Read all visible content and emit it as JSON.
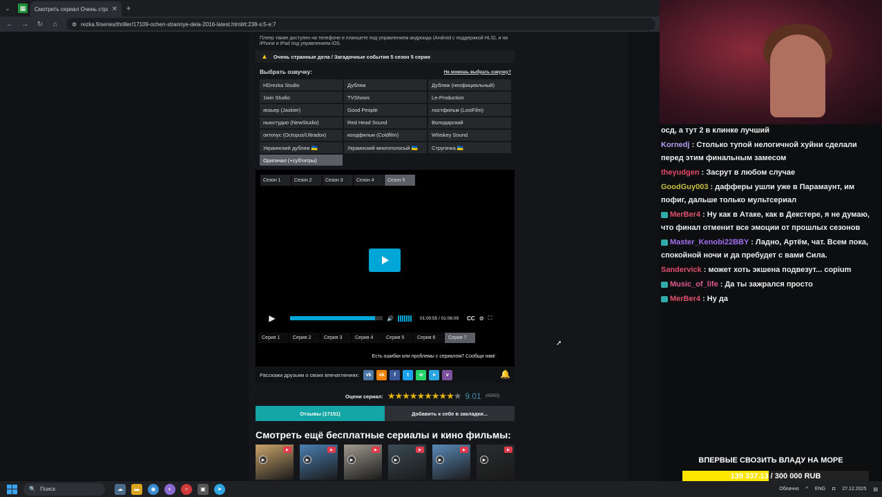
{
  "browser": {
    "tab_title": "Смотреть сериал Очень стра...",
    "tab_close": "✕",
    "new_tab": "+",
    "url": "rezka.fi/series/thriller/17109-ochen-strannye-dela-2016-latest.html#t:238-s:5-e:7"
  },
  "page": {
    "notice": "Плеер также доступен на телефоне и планшете под управлением андроида (Android с поддержкой HLS), и на iPhone и iPad под управлением iOS.",
    "episode_title": "Очень странные дела / Загадочные события 5 сезон 5 серия",
    "voice_label": "Выбрать озвучку:",
    "voice_help": "Не можешь выбрать озвучку?",
    "voices": [
      "HDrezka Studio",
      "Дубляж",
      "Дубляж (неофициальный)",
      "1win Studio",
      "TVShows",
      "Le-Production",
      "яскьер (Jaskier)",
      "Good People",
      "лостфильм (LostFilm)",
      "ньюстудио (NewStudio)",
      "Red Head Sound",
      "Володарский",
      "октопус (Octopus/Ultradox)",
      "колдфильм (Coldfilm)",
      "Whiskey Sound",
      "Украинский дубляж 🇺🇦",
      "Украинский многоголосый 🇺🇦",
      "Стругачка 🇺🇦",
      "Оригинал (+субтитры)"
    ],
    "active_voice": "Оригинал (+субтитры)",
    "seasons": [
      "Сезон 1",
      "Сезон 2",
      "Сезон 3",
      "Сезон 4",
      "Сезон 5"
    ],
    "active_season": "Сезон 5",
    "episodes": [
      "Серия 1",
      "Серия 2",
      "Серия 3",
      "Серия 4",
      "Серия 5",
      "Серия 6",
      "Серия 7"
    ],
    "active_episode": "Серия 7",
    "player": {
      "time": "01:00:55 / 01:06:09",
      "progress": 0.92,
      "cc_label": "CC"
    },
    "error_text": "Есть ошибки или проблемы с сериалом? Сообщи нам!",
    "share_label": "Расскажи друзьям о своих впечатлениях:",
    "social": [
      {
        "name": "vk-icon",
        "glyph": "vk",
        "color": "#4c75a3"
      },
      {
        "name": "ok-icon",
        "glyph": "ok",
        "color": "#ee8208"
      },
      {
        "name": "facebook-icon",
        "glyph": "f",
        "color": "#3b5998"
      },
      {
        "name": "twitter-icon",
        "glyph": "t",
        "color": "#1da1f2"
      },
      {
        "name": "whatsapp-icon",
        "glyph": "w",
        "color": "#25d366"
      },
      {
        "name": "telegram-icon",
        "glyph": "➤",
        "color": "#2ca5e0"
      },
      {
        "name": "viber-icon",
        "glyph": "v",
        "color": "#7b519d"
      }
    ],
    "rating_label": "Оцени сериал:",
    "rating_score": "9.01",
    "rating_votes": "(45853)",
    "rating_stars": 9,
    "reviews_button": "Отзывы (17151)",
    "bookmark_button": "Добавить к себе в закладки...",
    "more_title": "Смотреть ещё бесплатные сериалы и кино фильмы:",
    "thumbs": [
      {
        "color": "#c9a46a"
      },
      {
        "color": "#4a7fb0"
      },
      {
        "color": "#a09a90"
      },
      {
        "color": "#3b4a55"
      },
      {
        "color": "#5a8ab8"
      },
      {
        "color": "#2a2c2e"
      }
    ]
  },
  "stream": {
    "chat": [
      {
        "user": "",
        "text": "осд, а тут 2 в клинке лучший",
        "color": "#eee",
        "badge": false
      },
      {
        "user": "Kornedj",
        "text": " : Столько тупой нелогичной хуйни сделали перед этим финальным замесом",
        "color": "#b49cf0",
        "badge": false
      },
      {
        "user": "theyudgen",
        "text": " : Засрут в любом случае",
        "color": "#e04a6a",
        "badge": false
      },
      {
        "user": "GoodGuy003",
        "text": " : дафферы ушли уже в Парамаунт, им пофиг, дальше только мультсериал",
        "color": "#c8c040",
        "badge": false
      },
      {
        "user": "MerBer4",
        "text": " : Ну как в Атаке, как в Декстере, я не думаю, что финал отменит все эмоции от прошлых сезонов",
        "color": "#e0506a",
        "badge": true
      },
      {
        "user": "Master_Kenobi22BBY",
        "text": " : Ладно, Артём, чат. Всем пока, спокойной ночи и да пребудет с вами Сила.",
        "color": "#a070f0",
        "badge": true
      },
      {
        "user": "Sandervick",
        "text": " : может хоть экшена подвезут... copium",
        "color": "#e0506a",
        "badge": false
      },
      {
        "user": "Music_of_life",
        "text": " : Да ты зажрался просто",
        "color": "#e05a8a",
        "badge": true
      },
      {
        "user": "MerBer4",
        "text": " : Ну да",
        "color": "#e0506a",
        "badge": true
      }
    ],
    "promo": "ВПЕРВЫЕ СВОЗИТЬ ВЛАДУ НА МОРЕ",
    "donation_text": "139 337.13 / 300 000 RUB",
    "donation_progress": 0.464
  },
  "taskbar": {
    "search_placeholder": "Поиск",
    "weather": "Облачно",
    "lang": "ENG",
    "date": "27.12.2025"
  }
}
